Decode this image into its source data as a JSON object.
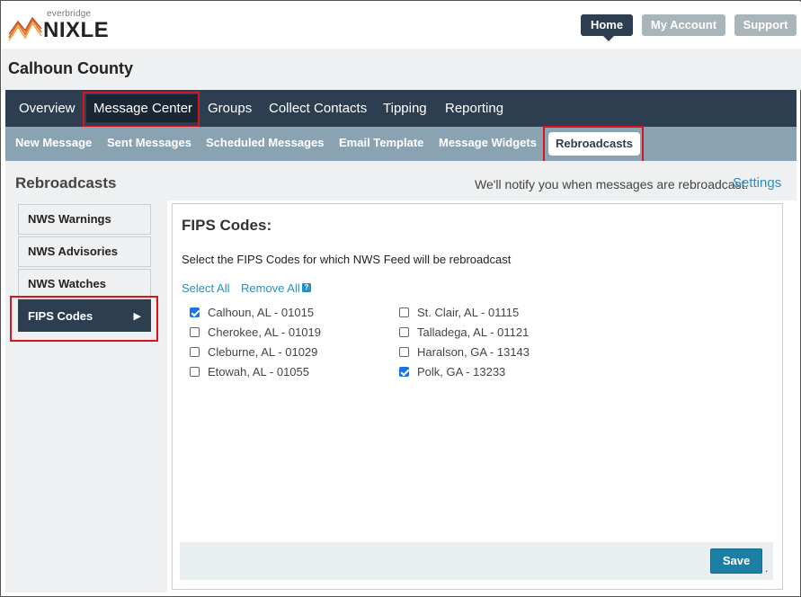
{
  "header": {
    "logo_small": "everbridge",
    "logo_big": "NIXLE",
    "nav": [
      {
        "label": "Home"
      },
      {
        "label": "My Account"
      },
      {
        "label": "Support"
      }
    ]
  },
  "county_name": "Calhoun County",
  "main_nav": [
    {
      "label": "Overview"
    },
    {
      "label": "Message Center",
      "active": true
    },
    {
      "label": "Groups"
    },
    {
      "label": "Collect Contacts"
    },
    {
      "label": "Tipping"
    },
    {
      "label": "Reporting"
    }
  ],
  "sub_nav": [
    {
      "label": "New Message"
    },
    {
      "label": "Sent Messages"
    },
    {
      "label": "Scheduled Messages"
    },
    {
      "label": "Email Template"
    },
    {
      "label": "Message Widgets"
    },
    {
      "label": "Rebroadcasts",
      "active": true
    }
  ],
  "section": {
    "title": "Rebroadcasts",
    "notify_text": "We'll notify you when messages are rebroadcast.",
    "settings_link": "Settings"
  },
  "sidebar": [
    {
      "label": "NWS Warnings"
    },
    {
      "label": "NWS Advisories"
    },
    {
      "label": "NWS Watches"
    },
    {
      "label": "FIPS Codes",
      "active": true
    }
  ],
  "panel": {
    "title": "FIPS Codes:",
    "description": "Select the FIPS Codes for which NWS Feed will be rebroadcast",
    "select_all": "Select All",
    "remove_all": "Remove All",
    "help_icon": "?",
    "fips_left": [
      {
        "label": "Calhoun, AL - 01015",
        "checked": true
      },
      {
        "label": "Cherokee, AL - 01019",
        "checked": false
      },
      {
        "label": "Cleburne, AL - 01029",
        "checked": false
      },
      {
        "label": "Etowah, AL - 01055",
        "checked": false
      }
    ],
    "fips_right": [
      {
        "label": "St. Clair, AL - 01115",
        "checked": false
      },
      {
        "label": "Talladega, AL - 01121",
        "checked": false
      },
      {
        "label": "Haralson, GA - 13143",
        "checked": false
      },
      {
        "label": "Polk, GA - 13233",
        "checked": true
      }
    ],
    "save_label": "Save",
    "trailing_dot": "."
  },
  "colors": {
    "nav_dark": "#2c3e50",
    "subnav": "#8aa3b3",
    "link": "#2a8fc2",
    "highlight": "#d9141c",
    "save": "#1d7fa5"
  }
}
